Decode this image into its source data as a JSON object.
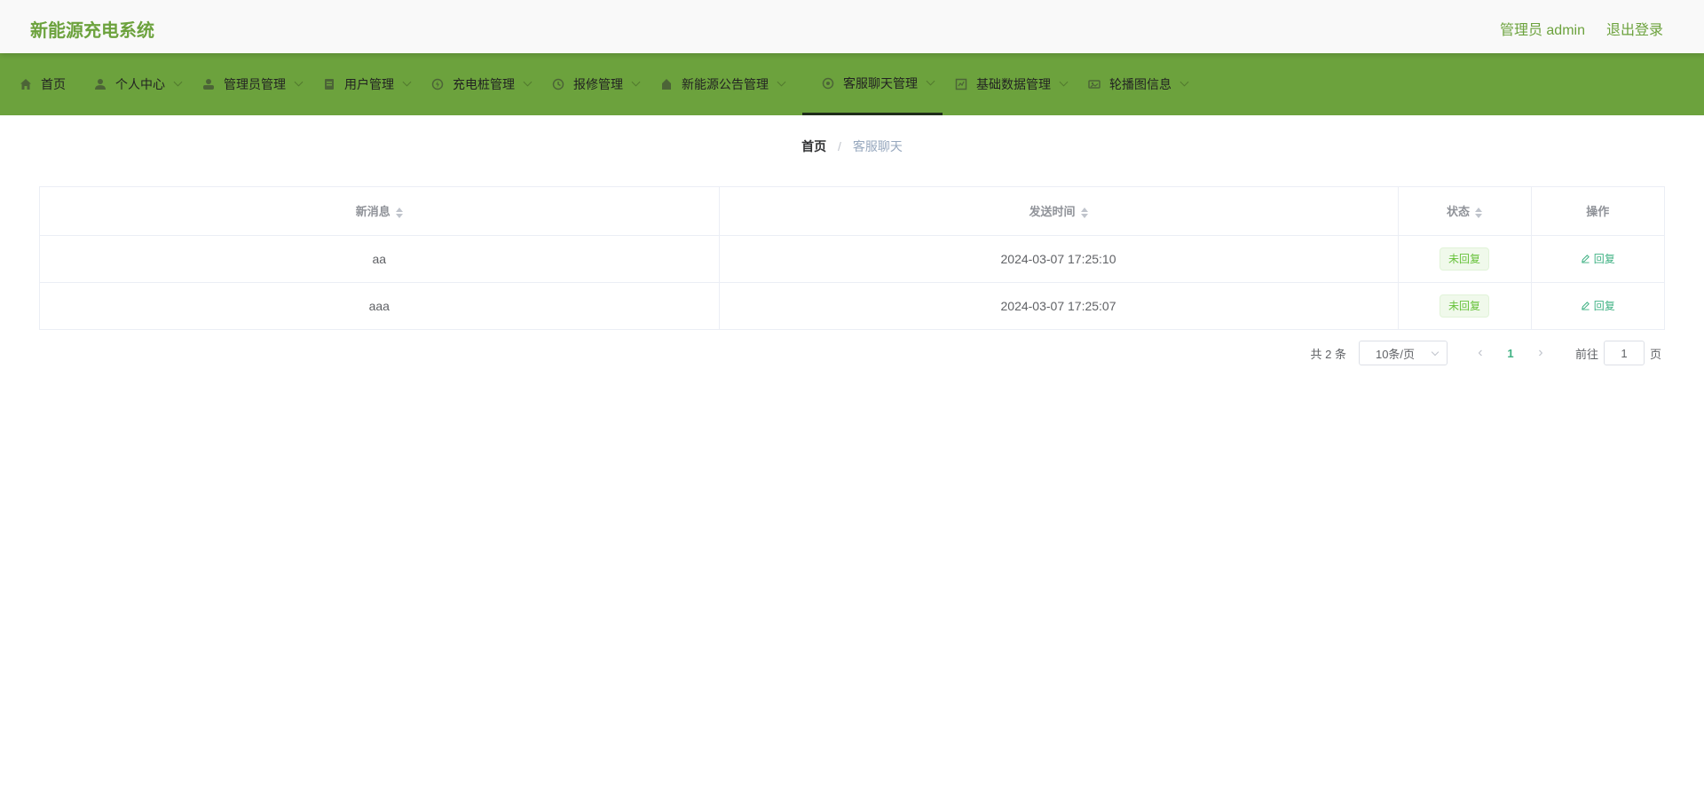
{
  "app": {
    "title": "新能源充电系统"
  },
  "user": {
    "role_label": "管理员 admin",
    "logout_label": "退出登录"
  },
  "nav": {
    "items": [
      {
        "label": "首页",
        "icon": "home-icon"
      },
      {
        "label": "个人中心",
        "icon": "user-icon"
      },
      {
        "label": "管理员管理",
        "icon": "admin-icon"
      },
      {
        "label": "用户管理",
        "icon": "users-icon"
      },
      {
        "label": "充电桩管理",
        "icon": "charger-icon"
      },
      {
        "label": "报修管理",
        "icon": "repair-icon"
      },
      {
        "label": "新能源公告管理",
        "icon": "notice-icon"
      },
      {
        "label": "客服聊天管理",
        "icon": "chat-icon"
      },
      {
        "label": "基础数据管理",
        "icon": "data-icon"
      },
      {
        "label": "轮播图信息",
        "icon": "carousel-icon"
      }
    ],
    "active_index": 7
  },
  "breadcrumb": {
    "home": "首页",
    "separator": "/",
    "current": "客服聊天"
  },
  "table": {
    "headers": {
      "message": "新消息",
      "time": "发送时间",
      "status": "状态",
      "action": "操作"
    },
    "rows": [
      {
        "message": "aa",
        "time": "2024-03-07 17:25:10",
        "status": "未回复",
        "action": "回复"
      },
      {
        "message": "aaa",
        "time": "2024-03-07 17:25:07",
        "status": "未回复",
        "action": "回复"
      }
    ]
  },
  "pagination": {
    "total_text": "共 2 条",
    "page_size": "10条/页",
    "prev": "‹",
    "current_page": "1",
    "next": "›",
    "goto_label": "前往",
    "goto_value": "1",
    "page_suffix": "页"
  },
  "colors": {
    "accent": "#6ca23d",
    "link": "#3fb183",
    "tag_text": "#67c23a"
  }
}
